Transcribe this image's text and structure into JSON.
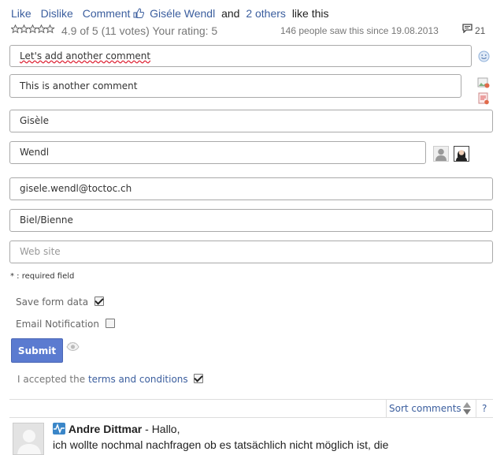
{
  "actions": {
    "like": "Like",
    "dislike": "Dislike",
    "comment": "Comment",
    "liker_name": "Giséle Wendl",
    "and_text": "and",
    "others": "2 others",
    "like_this": "like this"
  },
  "rating": {
    "stars_icon": "star-rating-icon",
    "text": "4.9 of 5 (11 votes) Your rating: 5"
  },
  "views": {
    "text": "146 people saw this since 19.08.2013"
  },
  "comments_count": "21",
  "form": {
    "comment_title": "Let's add another comment",
    "comment_body": "This is another comment",
    "first_name": "Gisèle",
    "last_name": "Wendl",
    "email": "gisele.wendl@toctoc.ch",
    "location": "Biel/Bienne",
    "website_placeholder": "Web site",
    "required_note": "* : required field",
    "save_form_data": "Save form data",
    "save_form_checked": true,
    "email_notification": "Email Notification",
    "email_notification_checked": false,
    "submit_label": "Submit",
    "terms_prefix": "I accepted the",
    "terms_link": "terms and conditions",
    "terms_checked": true
  },
  "sort": {
    "label": "Sort comments",
    "help": "?"
  },
  "first_comment": {
    "author": "Andre Dittmar",
    "greeting": "- Hallo,",
    "text": "ich wollte nochmal nachfragen ob es tatsächlich nicht möglich ist, die"
  },
  "colors": {
    "link": "#3b5e9e",
    "submit": "#5b7bd0",
    "field_border": "#a9a9a9"
  }
}
